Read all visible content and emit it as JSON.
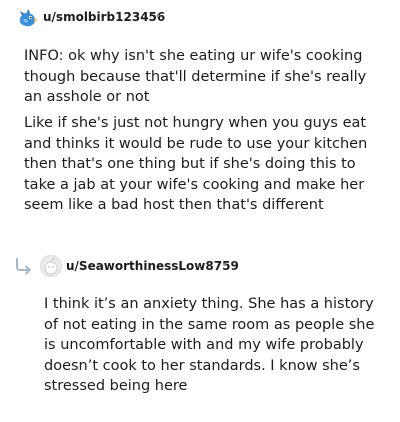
{
  "comments": [
    {
      "username": "u/smolbirb123456",
      "separator": "•",
      "avatar_icon": "blue-bird-avatar-icon",
      "paragraphs": [
        "INFO: ok why isn't she eating ur wife's cooking though because that'll determine if she's really an asshole or not",
        "Like if she's just not hungry when you guys eat and thinks it would be rude to use your kitchen then that's one thing but if she's doing this to take a jab at your wife's cooking and make her seem like a bad host then that's different"
      ]
    },
    {
      "username": "u/SeaworthinessLow8759",
      "separator": "•",
      "avatar_icon": "default-snoo-avatar-icon",
      "reply_icon": "reply-arrow-icon",
      "paragraphs": [
        "I think it’s an anxiety thing. She has a history of not eating in the same room as people she is uncomfortable with and my wife probably doesn’t cook to her standards. I know she’s stressed being here"
      ]
    }
  ],
  "colors": {
    "text": "#1c1c1c",
    "meta": "#878a8c",
    "reply_arrow": "#a5b7c9",
    "avatar_bird": "#3a8fd6"
  }
}
